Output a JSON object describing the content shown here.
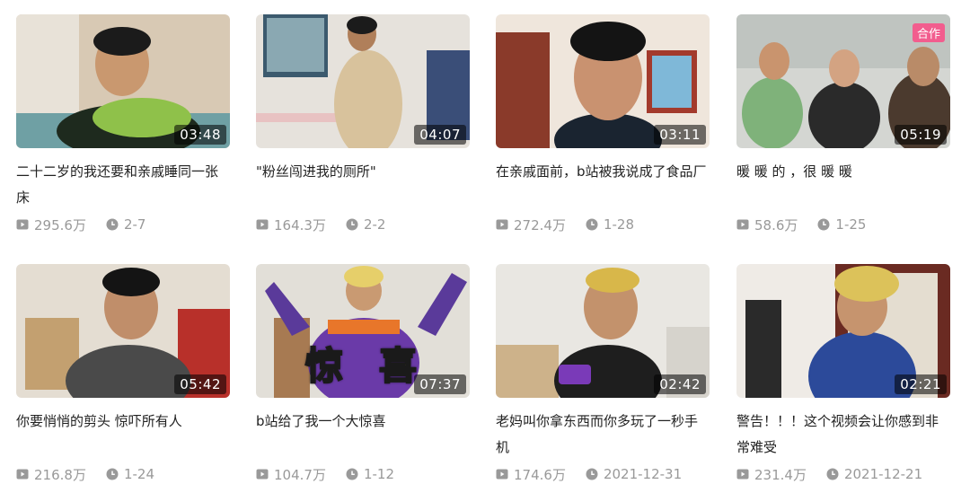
{
  "videos": [
    {
      "title": "二十二岁的我还要和亲戚睡同一张床",
      "duration": "03:48",
      "views": "295.6万",
      "date": "2-7",
      "badge": null
    },
    {
      "title": "\"粉丝闯进我的厕所\"",
      "duration": "04:07",
      "views": "164.3万",
      "date": "2-2",
      "badge": null
    },
    {
      "title": "在亲戚面前，b站被我说成了食品厂",
      "duration": "03:11",
      "views": "272.4万",
      "date": "1-28",
      "badge": null
    },
    {
      "title": "暖 暖 的 ，很 暖 暖",
      "duration": "05:19",
      "views": "58.6万",
      "date": "1-25",
      "badge": "合作"
    },
    {
      "title": "你要悄悄的剪头 惊吓所有人",
      "duration": "05:42",
      "views": "216.8万",
      "date": "1-24",
      "badge": null
    },
    {
      "title": "b站给了我一个大惊喜",
      "duration": "07:37",
      "views": "104.7万",
      "date": "1-12",
      "badge": null,
      "overlay": [
        "惊",
        "喜"
      ]
    },
    {
      "title": "老妈叫你拿东西而你多玩了一秒手机",
      "duration": "02:42",
      "views": "174.6万",
      "date": "2021-12-31",
      "badge": null
    },
    {
      "title": "警告！！！这个视频会让你感到非常难受",
      "duration": "02:21",
      "views": "231.4万",
      "date": "2021-12-21",
      "badge": null
    }
  ],
  "icons": {
    "views": "play-count-icon",
    "date": "clock-icon"
  },
  "colors": {
    "badge": "#f25d8e",
    "meta": "#999999",
    "title": "#222222"
  }
}
